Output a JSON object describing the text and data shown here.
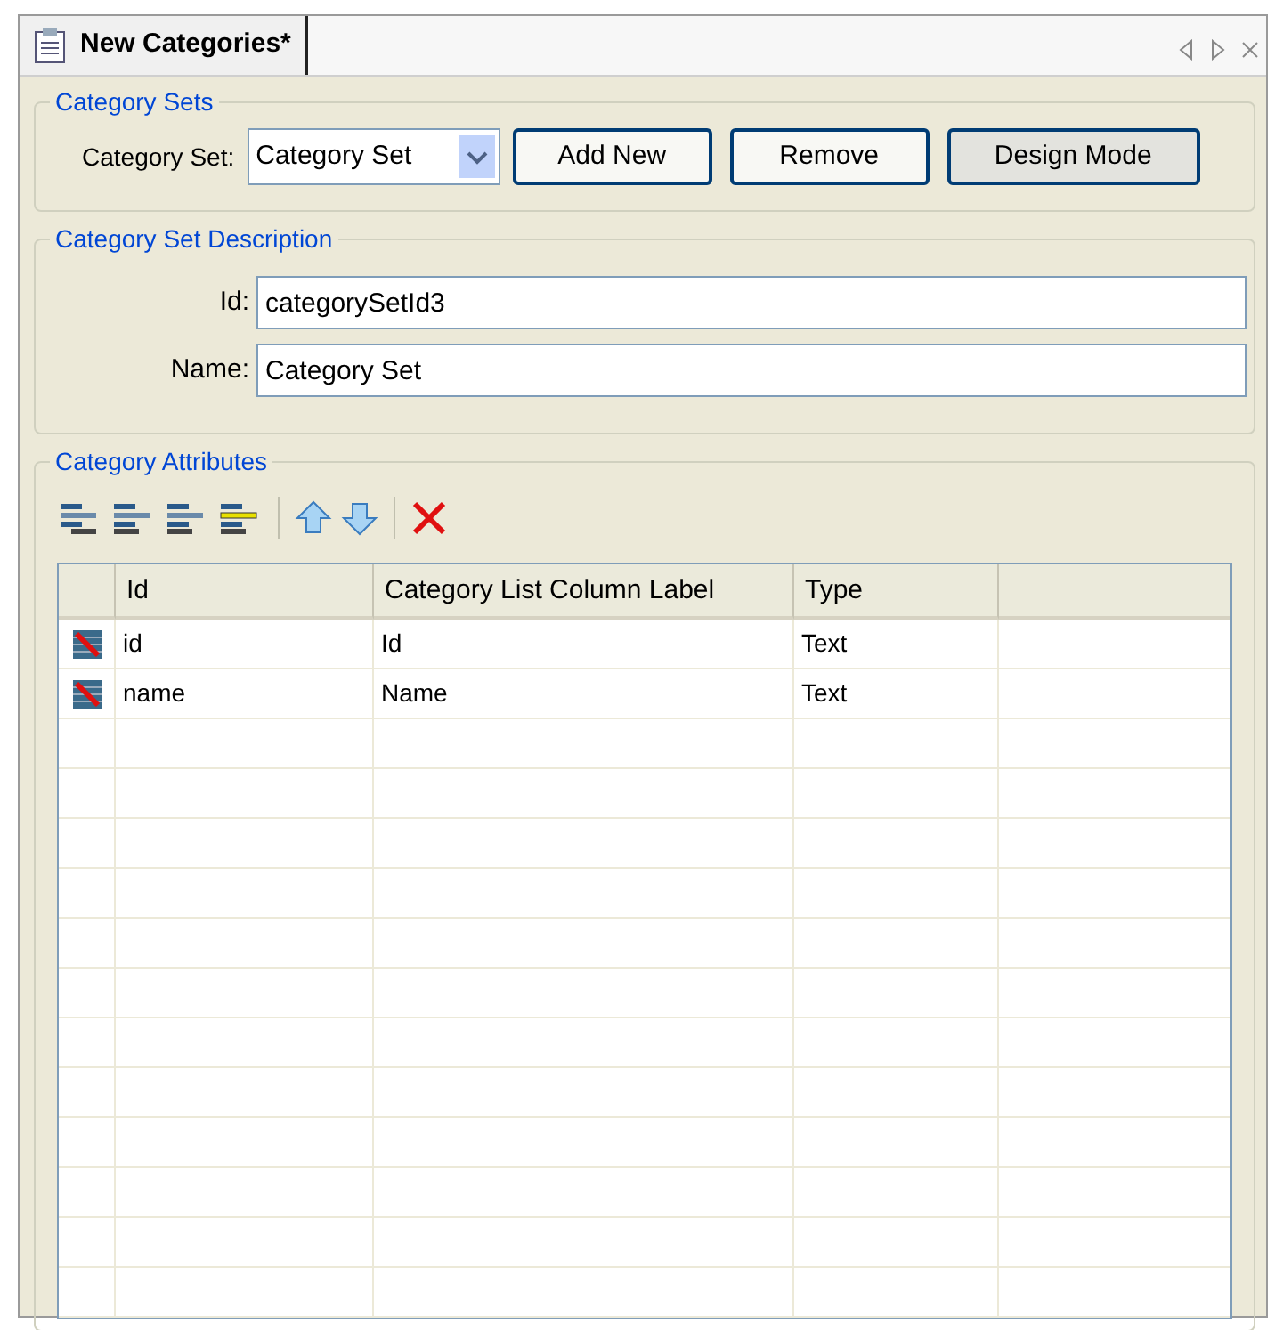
{
  "tab": {
    "title": "New Categories*"
  },
  "category_sets": {
    "legend": "Category Sets",
    "label": "Category Set:",
    "value": "Category Set",
    "buttons": [
      "Add New",
      "Remove",
      "Design Mode"
    ]
  },
  "description": {
    "legend": "Category Set Description",
    "fields": [
      {
        "label": "Id:",
        "value": "categorySetId3"
      },
      {
        "label": "Name:",
        "value": "Category Set"
      }
    ]
  },
  "attributes": {
    "legend": "Category Attributes",
    "table": {
      "columns": [
        "Id",
        "Category List Column Label",
        "Type"
      ],
      "rows": [
        {
          "id": "id",
          "label": "Id",
          "type": "Text"
        },
        {
          "id": "name",
          "label": "Name",
          "type": "Text"
        }
      ]
    }
  }
}
